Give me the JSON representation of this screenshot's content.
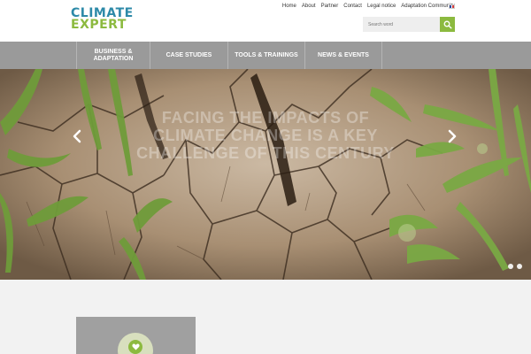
{
  "logo": {
    "line1": "CLIMATE",
    "line2": "EXPERT"
  },
  "top_nav": [
    "Home",
    "About",
    "Partner",
    "Contact",
    "Legal notice",
    "Adaptation Community"
  ],
  "language_flag": "french-flag",
  "search": {
    "placeholder": "Search word",
    "icon": "search-icon"
  },
  "main_nav": [
    {
      "line1": "BUSINESS &",
      "line2": "ADAPTATION"
    },
    {
      "line1": "CASE STUDIES",
      "line2": ""
    },
    {
      "line1": "TOOLS & TRAININGS",
      "line2": ""
    },
    {
      "line1": "NEWS & EVENTS",
      "line2": ""
    }
  ],
  "hero": {
    "caption": "FACING THE IMPACTS OF CLIMATE CHANGE IS A KEY CHALLENGE OF THIS CENTURY",
    "prev_icon": "chevron-left-icon",
    "next_icon": "chevron-right-icon",
    "slide_count": 2
  },
  "colors": {
    "brand_blue": "#2d8aa8",
    "brand_green": "#8cba3f",
    "nav_bg": "#9a9a9a"
  }
}
